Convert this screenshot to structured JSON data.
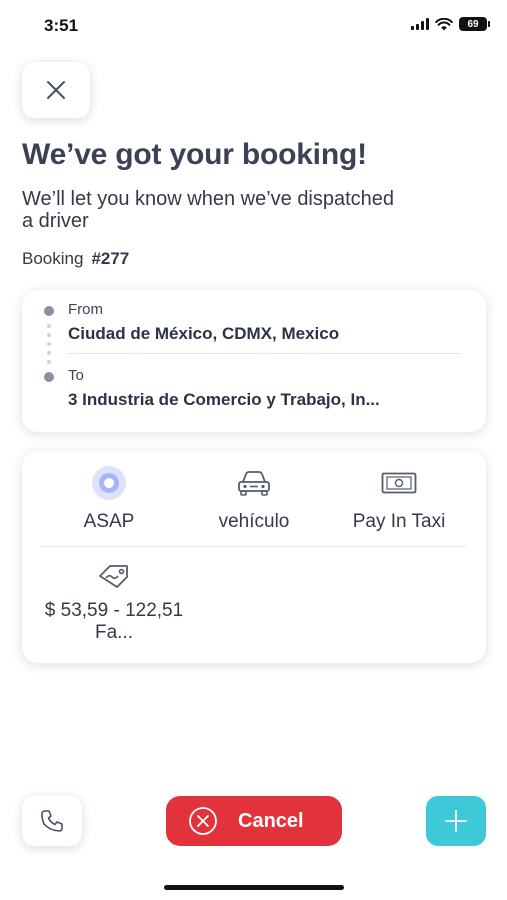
{
  "status_bar": {
    "time": "3:51",
    "battery": "69"
  },
  "header": {
    "title": "We’ve got your booking!",
    "subtitle": "We’ll let you know when we’ve dispatched a driver",
    "booking_label": "Booking",
    "booking_number": "#277"
  },
  "route": {
    "from_label": "From",
    "from_value": "Ciudad de México, CDMX,  Mexico",
    "to_label": "To",
    "to_value": "3 Industria de Comercio y Trabajo, In..."
  },
  "details": {
    "timing": "ASAP",
    "vehicle": "vehículo",
    "payment": "Pay In Taxi",
    "fare": "$ 53,59 - 122,51 Fa..."
  },
  "actions": {
    "cancel_label": "Cancel"
  },
  "colors": {
    "accent": "#3ec9d9",
    "cancel": "#e2333d",
    "pulse": "#6b7cf5"
  }
}
